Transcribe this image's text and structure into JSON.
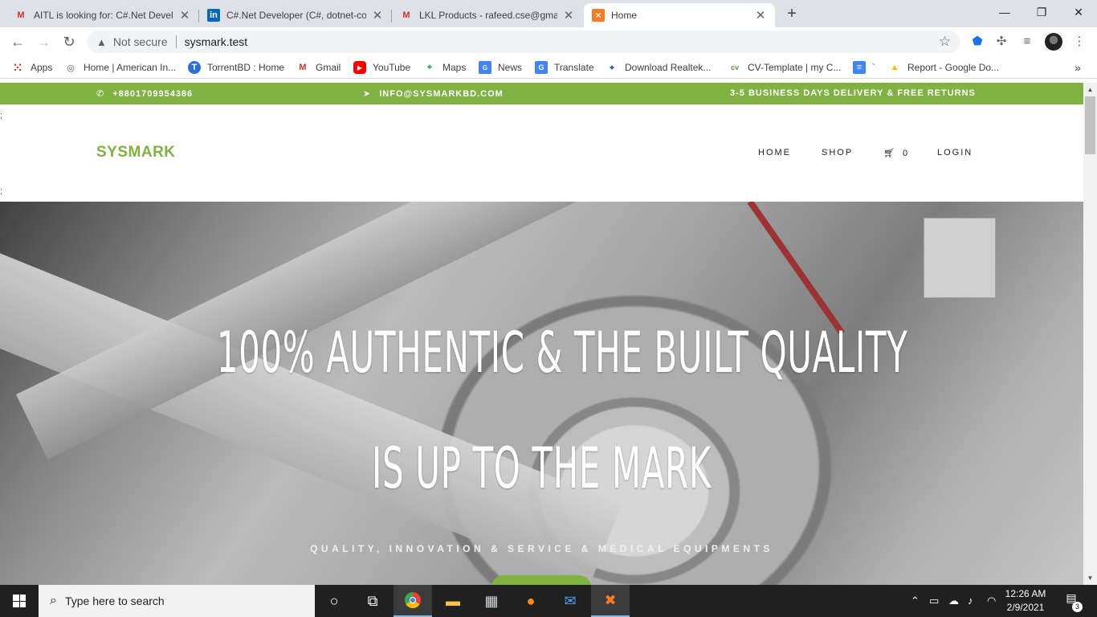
{
  "browser": {
    "tabs": [
      {
        "title": "AITL is looking for: C#.Net Develo",
        "icon": "gmail-icon",
        "active": false
      },
      {
        "title": "C#.Net Developer (C#, dotnet-co",
        "icon": "linkedin-icon",
        "active": false
      },
      {
        "title": "LKL Products - rafeed.cse@gmail",
        "icon": "gmail-icon",
        "active": false
      },
      {
        "title": "Home",
        "icon": "xampp-icon",
        "active": true
      }
    ],
    "new_tab": "+",
    "window_controls": {
      "minimize": "—",
      "restore": "❐",
      "close": "✕"
    },
    "omnibox": {
      "security": "Not secure",
      "url": "sysmark.test"
    },
    "bookmarks": [
      {
        "label": "Apps",
        "icon": "apps-grid-icon"
      },
      {
        "label": "Home | American In...",
        "icon": "globe-icon"
      },
      {
        "label": "TorrentBD : Home",
        "icon": "torrentbd-icon"
      },
      {
        "label": "Gmail",
        "icon": "gmail-icon"
      },
      {
        "label": "YouTube",
        "icon": "youtube-icon"
      },
      {
        "label": "Maps",
        "icon": "maps-icon"
      },
      {
        "label": "News",
        "icon": "news-icon"
      },
      {
        "label": "Translate",
        "icon": "translate-icon"
      },
      {
        "label": "Download Realtek...",
        "icon": "realtek-icon"
      },
      {
        "label": "CV-Template | my C...",
        "icon": "cv-icon"
      },
      {
        "label": "`",
        "icon": "docs-icon"
      },
      {
        "label": "Report - Google Do...",
        "icon": "drive-icon"
      }
    ],
    "bookmarks_overflow": "»"
  },
  "site": {
    "topbar": {
      "phone": "+8801709954386",
      "email": "INFO@SYSMARKBD.COM",
      "shipping": "3-5 BUSINESS DAYS DELIVERY & FREE RETURNS"
    },
    "stray_semicolon": ";",
    "logo": "SYSMARK",
    "nav": {
      "home": "HOME",
      "shop": "SHOP",
      "cart_count": "0",
      "login": "LOGIN"
    },
    "hero": {
      "title_line1": "100% AUTHENTIC & THE BUILT QUALITY",
      "title_line2": "IS UP TO THE MARK",
      "subtitle": "QUALITY, INNOVATION & SERVICE & MEDICAL EQUIPMENTS"
    }
  },
  "taskbar": {
    "search_placeholder": "Type here to search",
    "apps": [
      "cortana-icon",
      "task-view-icon",
      "chrome-icon",
      "file-explorer-icon",
      "store-icon",
      "firefox-icon",
      "mail-icon",
      "xampp-icon"
    ],
    "clock_time": "12:26 AM",
    "clock_date": "2/9/2021",
    "notifications": "3"
  },
  "colors": {
    "brand_green": "#7fb241",
    "tab_strip": "#dee1e6",
    "taskbar": "#202020"
  }
}
